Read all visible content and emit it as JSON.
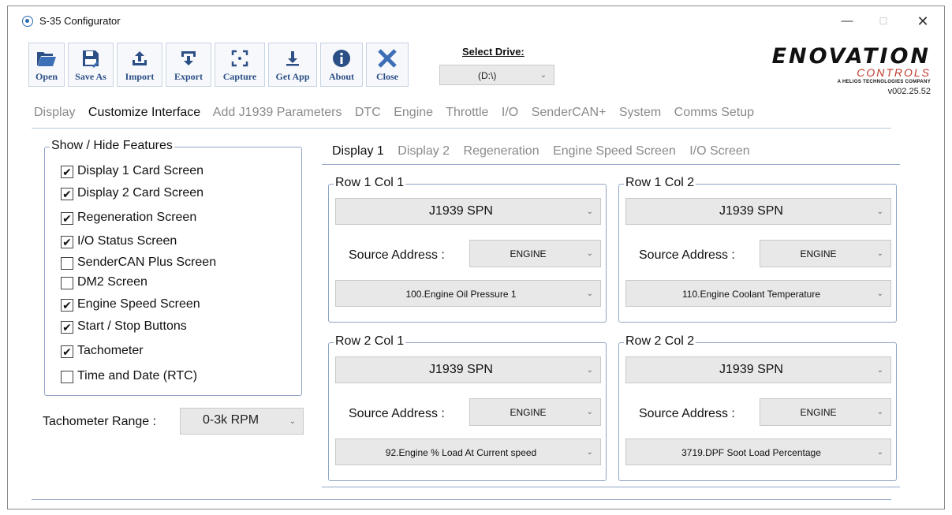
{
  "window": {
    "title": "S-35 Configurator",
    "minimize": "—",
    "maximize": "☐",
    "close": "✕"
  },
  "toolbar": {
    "open": "Open",
    "save_as": "Save As",
    "import": "Import",
    "export": "Export",
    "capture": "Capture",
    "get_app": "Get App",
    "about": "About",
    "close": "Close"
  },
  "drive": {
    "label": "Select Drive:",
    "value": "(D:\\)"
  },
  "logo": {
    "brand": "ENOVATION",
    "controls": "CONTROLS",
    "tagline": "A HELIOS TECHNOLOGIES COMPANY",
    "version": "v002.25.52"
  },
  "main_tabs": [
    "Display",
    "Customize Interface",
    "Add J1939 Parameters",
    "DTC",
    "Engine",
    "Throttle",
    "I/O",
    "SenderCAN+",
    "System",
    "Comms Setup"
  ],
  "features": {
    "title": "Show / Hide Features",
    "items": [
      {
        "label": "Display 1 Card Screen",
        "checked": "✔"
      },
      {
        "label": "Display 2 Card Screen",
        "checked": "✔"
      },
      {
        "label": "Regeneration Screen",
        "checked": "✔"
      },
      {
        "label": "I/O Status Screen",
        "checked": "✔"
      },
      {
        "label": "SenderCAN Plus Screen",
        "checked": ""
      },
      {
        "label": "DM2 Screen",
        "checked": ""
      },
      {
        "label": "Engine Speed Screen",
        "checked": "✔"
      },
      {
        "label": "Start / Stop Buttons",
        "checked": "✔"
      },
      {
        "label": "Tachometer",
        "checked": "✔"
      },
      {
        "label": "Time and Date (RTC)",
        "checked": ""
      }
    ]
  },
  "tach": {
    "label": "Tachometer Range :",
    "value": "0-3k RPM"
  },
  "sub_tabs": [
    "Display 1",
    "Display 2",
    "Regeneration",
    "Engine Speed Screen",
    "I/O Screen"
  ],
  "cards": [
    {
      "title": "Row 1 Col 1",
      "type": "J1939 SPN",
      "source_label": "Source Address :",
      "source": "ENGINE",
      "param": "100.Engine Oil Pressure 1"
    },
    {
      "title": "Row 1 Col 2",
      "type": "J1939 SPN",
      "source_label": "Source Address :",
      "source": "ENGINE",
      "param": "110.Engine Coolant Temperature"
    },
    {
      "title": "Row 2 Col 1",
      "type": "J1939 SPN",
      "source_label": "Source Address :",
      "source": "ENGINE",
      "param": "92.Engine % Load At Current speed"
    },
    {
      "title": "Row 2 Col 2",
      "type": "J1939 SPN",
      "source_label": "Source Address :",
      "source": "ENGINE",
      "param": "3719.DPF Soot Load Percentage"
    }
  ],
  "chevron": "⌄"
}
